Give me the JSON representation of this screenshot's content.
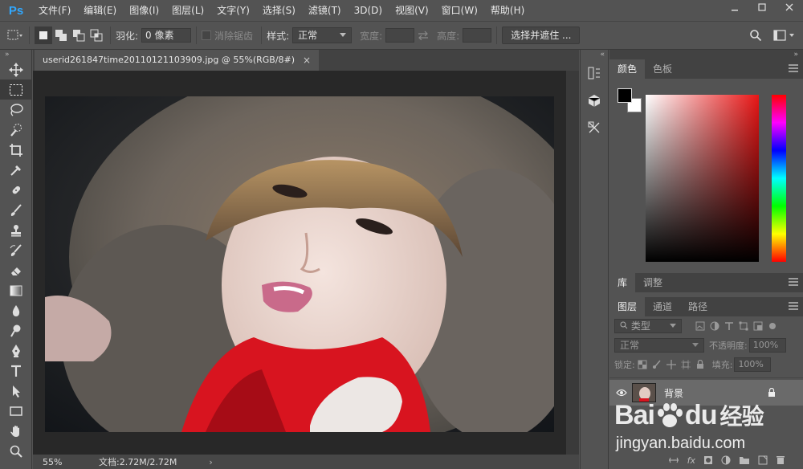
{
  "app": {
    "logo": "Ps",
    "menus": [
      "文件(F)",
      "编辑(E)",
      "图像(I)",
      "图层(L)",
      "文字(Y)",
      "选择(S)",
      "滤镜(T)",
      "3D(D)",
      "视图(V)",
      "窗口(W)",
      "帮助(H)"
    ]
  },
  "options_bar": {
    "feather_label": "羽化:",
    "feather_value": "0 像素",
    "antialias_label": "消除锯齿",
    "style_label": "样式:",
    "style_value": "正常",
    "width_label": "宽度:",
    "height_label": "高度:",
    "select_mask_button": "选择并遮住 ..."
  },
  "document": {
    "tab_title": "userid261847time20110121103909.jpg @ 55%(RGB/8#)",
    "close_glyph": "×",
    "zoom": "55%",
    "doc_info": "文档:2.72M/2.72M",
    "status_arrow": "›"
  },
  "color_panel": {
    "tabs": [
      "颜色",
      "色板"
    ],
    "foreground": "#000000",
    "background": "#ffffff",
    "hue": "#e81616"
  },
  "library_panel": {
    "tabs": [
      "库",
      "调整"
    ]
  },
  "layers_panel": {
    "tabs": [
      "图层",
      "通道",
      "路径"
    ],
    "filter_label": "类型",
    "blend_mode": "正常",
    "opacity_label": "不透明度:",
    "opacity_value": "100%",
    "lock_label": "锁定:",
    "fill_label": "填充:",
    "fill_value": "100%",
    "layers": [
      {
        "name": "背景",
        "visible": true,
        "locked": true
      }
    ]
  },
  "watermark": {
    "brand": "Bai",
    "brand2": "du",
    "brand_cn": "经验",
    "url": "jingyan.baidu.com"
  }
}
